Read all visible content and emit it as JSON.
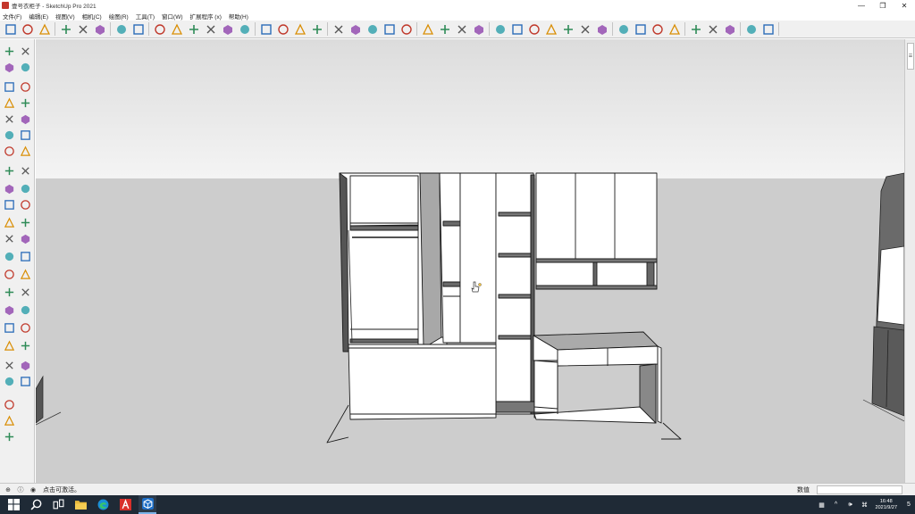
{
  "window": {
    "title": "壹号衣柜子 - SketchUp Pro 2021",
    "controls": {
      "minimize": "—",
      "maximize": "❐",
      "close": "✕"
    }
  },
  "menu": [
    {
      "label": "文件(F)"
    },
    {
      "label": "编辑(E)"
    },
    {
      "label": "视图(V)"
    },
    {
      "label": "相机(C)"
    },
    {
      "label": "绘图(R)"
    },
    {
      "label": "工具(T)"
    },
    {
      "label": "窗口(W)"
    },
    {
      "label": "扩展程序 (x)"
    },
    {
      "label": "帮助(H)"
    }
  ],
  "toolbar": {
    "icons": [
      "select-arrow-icon",
      "component-icon",
      "orbit-icon",
      "pan-icon",
      "zoom-icon",
      "zoom-extents-icon",
      "top-view-icon",
      "front-view-icon",
      "right-view-icon",
      "back-view-icon",
      "left-view-icon",
      "iso-view-icon",
      "warehouse-icon",
      "extension-icon",
      "protractor-icon",
      "axes-icon",
      "text-icon",
      "dimension-icon",
      "section-plane-icon",
      "paint-bucket-icon",
      "tape-measure-icon",
      "followme-icon",
      "offset-icon",
      "sandbox-icon",
      "shadow-icon",
      "fog-icon",
      "style-icon",
      "xray-icon",
      "wireframe-icon",
      "hidden-line-icon",
      "shaded-icon",
      "textured-icon",
      "monochrome-icon",
      "edge-icon",
      "profile-icon",
      "layer-icon",
      "outliner-icon",
      "scene-icon",
      "camera-icon",
      "walk-icon",
      "lookaround-icon",
      "position-camera-icon",
      "solid-union-icon",
      "solid-subtract-icon",
      "solid-intersect-icon",
      "solid-trim-icon",
      "solid-split-icon",
      "outer-shell-icon",
      "model-info-icon"
    ]
  },
  "status": {
    "help_text": "点击可激活。",
    "measurements_label": "数值",
    "measurements_value": ""
  },
  "taskbar": {
    "time": "16:48",
    "date": "2021/9/27",
    "notification_count": "5"
  },
  "colors": {
    "sky": "#e6e6e6",
    "ground": "#cfcfcf",
    "toolbar_bg": "#f0f0f0",
    "taskbar_bg": "#1f2a36",
    "accent": "#7cb3e8"
  }
}
